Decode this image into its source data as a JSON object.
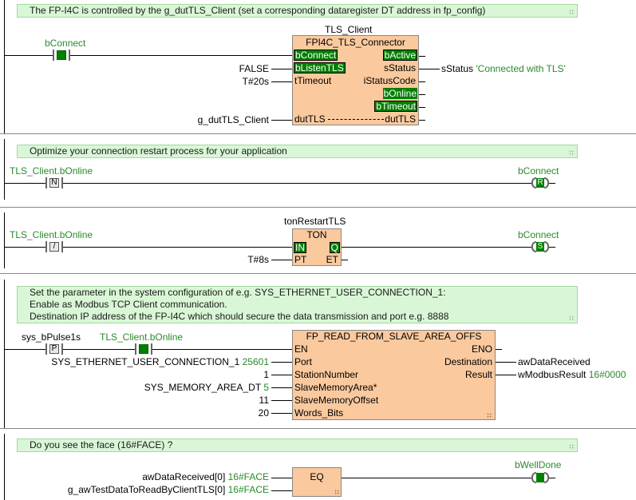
{
  "networks": [
    {
      "comment": "The FP-I4C is controlled by the g_dutTLS_Client (set a corresponding dataregister DT address in fp_config)",
      "contact_label": "bConnect",
      "instance": "TLS_Client",
      "fb_type": "FPI4C_TLS_Connector",
      "inputs": [
        "bConnect",
        "bListenTLS",
        "tTimeout",
        "dutTLS"
      ],
      "outputs": [
        "bActive",
        "sStatus",
        "iStatusCode",
        "bOnline",
        "bTimeout",
        "dutTLS"
      ],
      "input_values": [
        "FALSE",
        "T#20s",
        "g_dutTLS_Client"
      ],
      "status_var": "sStatus",
      "status_value": "'Connected with TLS'"
    },
    {
      "comment": "Optimize your connection restart process for your application",
      "contact_label": "TLS_Client.bOnline",
      "contact_symbol": "N",
      "coil_label": "bConnect",
      "coil_symbol": "R"
    },
    {
      "contact_label": "TLS_Client.bOnline",
      "contact_symbol": "/",
      "instance": "tonRestartTLS",
      "fb_type": "TON",
      "inputs": [
        "IN",
        "PT"
      ],
      "outputs": [
        "Q",
        "ET"
      ],
      "pt_value": "T#8s",
      "coil_label": "bConnect",
      "coil_symbol": "S"
    },
    {
      "comment_lines": [
        "Set the parameter in the system configuration of e.g. SYS_ETHERNET_USER_CONNECTION_1:",
        "Enable as Modbus TCP Client communication.",
        "Destination IP address of the FP-I4C which should secure the data transmission and port e.g. 8888"
      ],
      "contact1_label": "sys_bPulse1s",
      "contact1_symbol": "P",
      "contact2_label": "TLS_Client.bOnline",
      "fb_type": "FP_READ_FROM_SLAVE_AREA_OFFS",
      "inputs": [
        "EN",
        "Port",
        "StationNumber",
        "SlaveMemoryArea*",
        "SlaveMemoryOffset",
        "Words_Bits"
      ],
      "outputs": [
        "ENO",
        "Destination",
        "Result"
      ],
      "port_var": "SYS_ETHERNET_USER_CONNECTION_1",
      "port_value": "25601",
      "station_value": "1",
      "area_var": "SYS_MEMORY_AREA_DT",
      "area_value": "5",
      "offset_value": "11",
      "words_value": "20",
      "dest_var": "awDataReceived",
      "result_var": "wModbusResult",
      "result_value": "16#0000"
    },
    {
      "comment": "Do you see the face  (16#FACE)  ?",
      "in1_var": "awDataReceived[0]",
      "in1_value": "16#FACE",
      "in2_var": "g_awTestDataToReadByClientTLS[0]",
      "in2_value": "16#FACE",
      "fb_type": "EQ",
      "coil_label": "bWellDone"
    }
  ]
}
